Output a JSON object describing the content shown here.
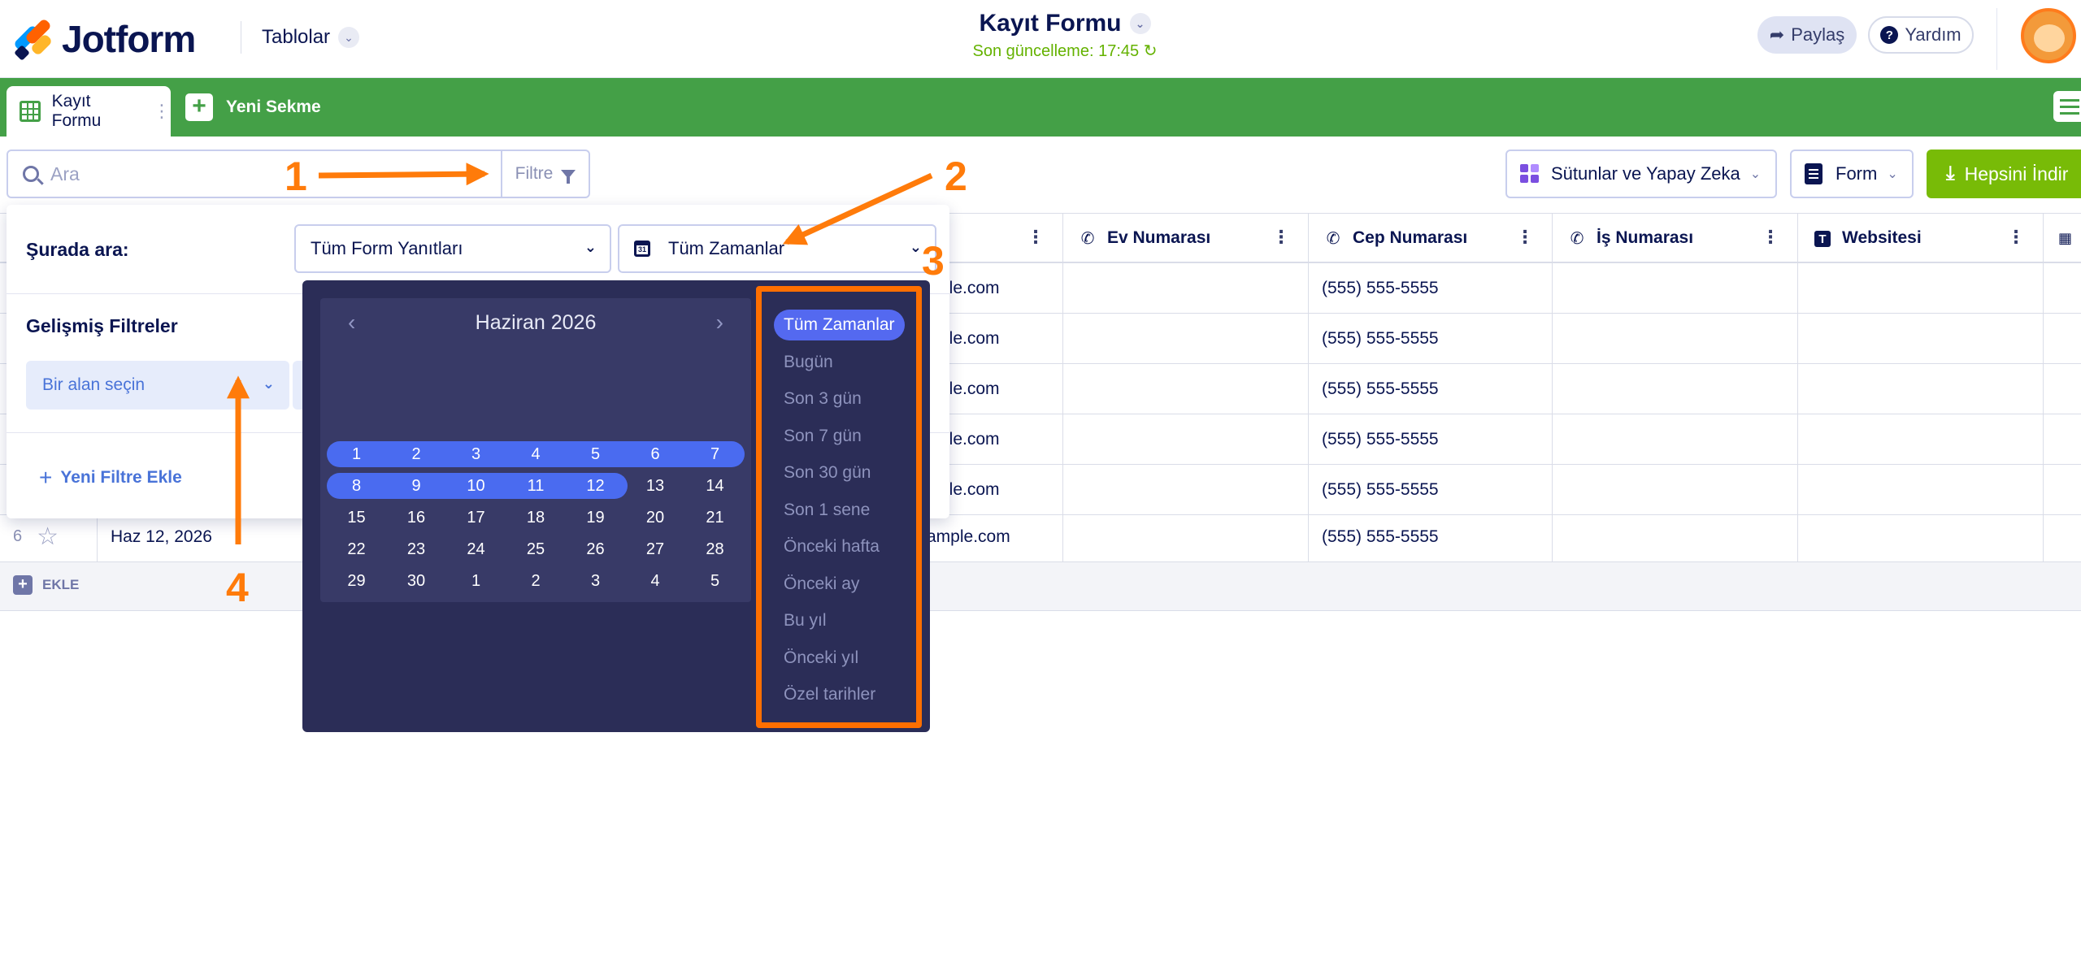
{
  "header": {
    "logo_text": "Jotform",
    "tables_label": "Tablolar",
    "title": "Kayıt Formu",
    "subtitle": "Son güncelleme: 17:45",
    "share_label": "Paylaş",
    "help_label": "Yardım"
  },
  "tabs": {
    "active_label": "Kayıt Formu",
    "new_tab_label": "Yeni Sekme"
  },
  "toolbar": {
    "search_placeholder": "Ara",
    "filter_label": "Filtre",
    "columns_ai_label": "Sütunlar ve Yapay Zeka",
    "form_label": "Form",
    "download_label": "Hepsini İndir"
  },
  "table": {
    "columns": [
      {
        "label": "Ev Numarası",
        "icon": "phone-icon"
      },
      {
        "label": "Cep Numarası",
        "icon": "phone-icon"
      },
      {
        "label": "İş Numarası",
        "icon": "phone-icon"
      },
      {
        "label": "Websitesi",
        "icon": "text-icon"
      }
    ],
    "rows": [
      {
        "email": "ple.com",
        "mobile": "(555) 555-5555"
      },
      {
        "email": "ple.com",
        "mobile": "(555) 555-5555"
      },
      {
        "email": "ple.com",
        "mobile": "(555) 555-5555"
      },
      {
        "email": "ple.com",
        "mobile": "(555) 555-5555"
      },
      {
        "email": "ple.com",
        "mobile": "(555) 555-5555"
      },
      {
        "num": "6",
        "date": "Haz 12, 2026",
        "email": "ample.com",
        "mobile": "(555) 555-5555"
      }
    ],
    "add_row_label": "EKLE"
  },
  "filter_panel": {
    "search_in_label": "Şurada ara:",
    "scope_value": "Tüm Form Yanıtları",
    "date_value": "Tüm Zamanlar",
    "advanced_label": "Gelişmiş Filtreler",
    "field_placeholder": "Bir alan seçin",
    "add_filter_label": "Yeni Filtre Ekle"
  },
  "date_picker": {
    "month_label": "Haziran 2026",
    "weeks": [
      [
        "1",
        "2",
        "3",
        "4",
        "5",
        "6",
        "7"
      ],
      [
        "8",
        "9",
        "10",
        "11",
        "12",
        "13",
        "14"
      ],
      [
        "15",
        "16",
        "17",
        "18",
        "19",
        "20",
        "21"
      ],
      [
        "22",
        "23",
        "24",
        "25",
        "26",
        "27",
        "28"
      ],
      [
        "29",
        "30",
        "1",
        "2",
        "3",
        "4",
        "5"
      ]
    ],
    "presets": [
      "Tüm Zamanlar",
      "Bugün",
      "Son 3 gün",
      "Son 7 gün",
      "Son 30 gün",
      "Son 1 sene",
      "Önceki hafta",
      "Önceki ay",
      "Bu yıl",
      "Önceki yıl",
      "Özel tarihler"
    ],
    "selected_preset": "Tüm Zamanlar"
  },
  "annotations": [
    "1",
    "2",
    "3",
    "4"
  ],
  "colors": {
    "brand_green": "#44a047",
    "download_green": "#78bb07",
    "annotation_orange": "#ff7b0a",
    "picker_bg": "#2b2d57",
    "range_blue": "#4a6bf0"
  }
}
